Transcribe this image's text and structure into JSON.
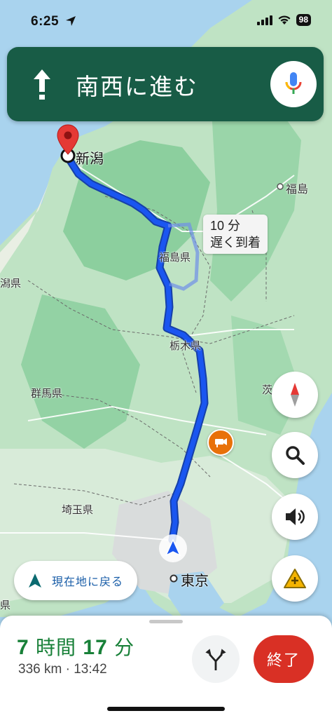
{
  "status": {
    "time": "6:25",
    "battery": "98"
  },
  "banner": {
    "direction": "南西に進む",
    "icon": "straight-arrow-icon",
    "mic_icon": "mic-icon"
  },
  "map": {
    "destination": "新潟",
    "labels": {
      "fukushima_city": "福島",
      "fukushima_pref": "福島県",
      "tochigi_pref": "栃木県",
      "gunma_pref": "群馬県",
      "saitama_pref": "埼玉県",
      "niigata_pref_partial": "潟県",
      "ibaraki_partial": "茨",
      "tokyo": "東京",
      "edge_ken": "県"
    },
    "delay_tag": {
      "line1": "10 分",
      "line2": "遅く到着"
    },
    "route_color": "#1a56f0"
  },
  "controls": {
    "compass_icon": "compass-icon",
    "search_icon": "search-icon",
    "sound_icon": "speaker-icon",
    "report_icon": "report-incident-icon",
    "recenter_label": "現在地に戻る"
  },
  "bottom": {
    "hours_num": "7",
    "hours_unit": "時間",
    "minutes_num": "17",
    "minutes_unit": "分",
    "meta": "336 km · 13:42",
    "end_label": "終了"
  }
}
